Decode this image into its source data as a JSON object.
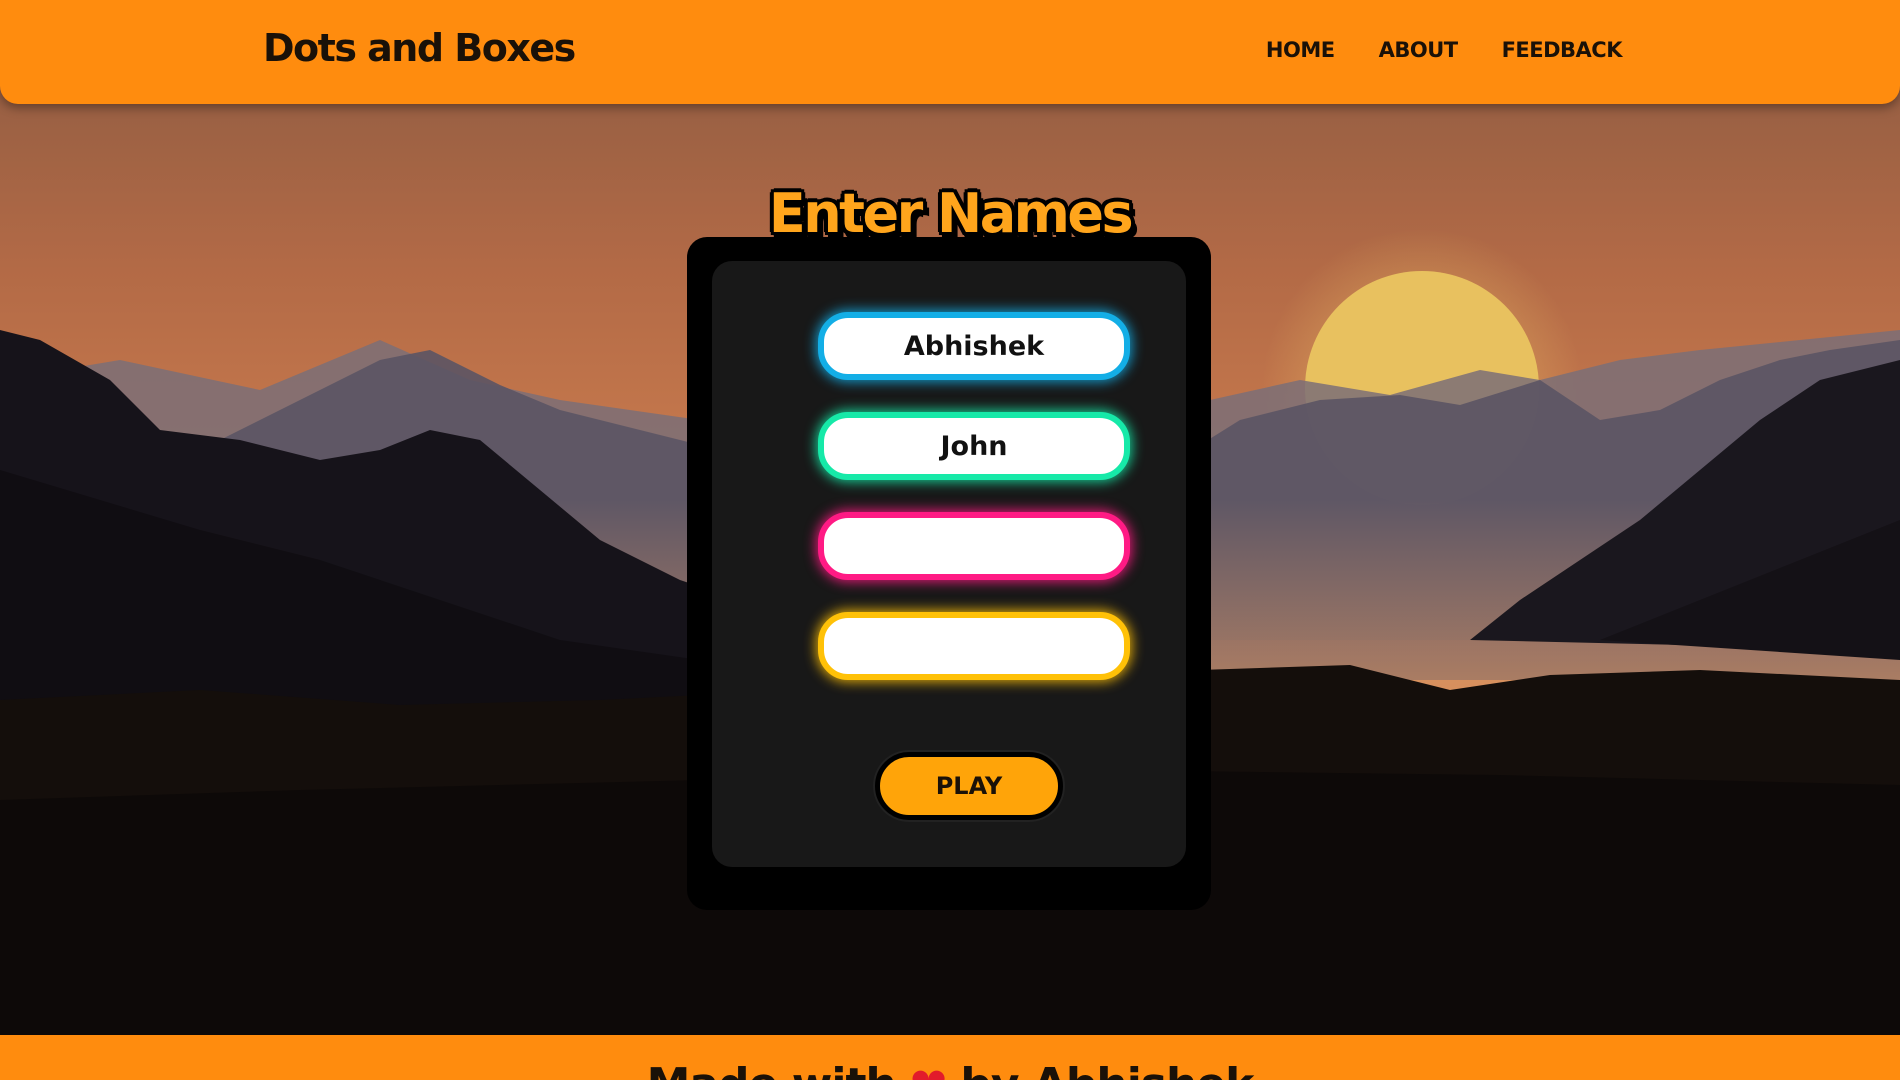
{
  "header": {
    "brand": "Dots and Boxes",
    "nav": [
      "HOME",
      "ABOUT",
      "FEEDBACK"
    ]
  },
  "card": {
    "title": "Enter Names",
    "players": [
      {
        "value": "Abhishek",
        "placeholder": "",
        "color": "#13aee6"
      },
      {
        "value": "John",
        "placeholder": "",
        "color": "#16e9a8"
      },
      {
        "value": "",
        "placeholder": "",
        "color": "#ff1a84"
      },
      {
        "value": "",
        "placeholder": "",
        "color": "#ffc107"
      }
    ],
    "play_label": "PLAY"
  },
  "footer": {
    "prefix": "Made with",
    "heart_icon": "heart-icon",
    "suffix": "by Abhishek"
  },
  "colors": {
    "brand_orange": "#ff8c0e",
    "title_orange": "#ffa51c",
    "card_black": "#000000",
    "card_inner": "#181818"
  }
}
